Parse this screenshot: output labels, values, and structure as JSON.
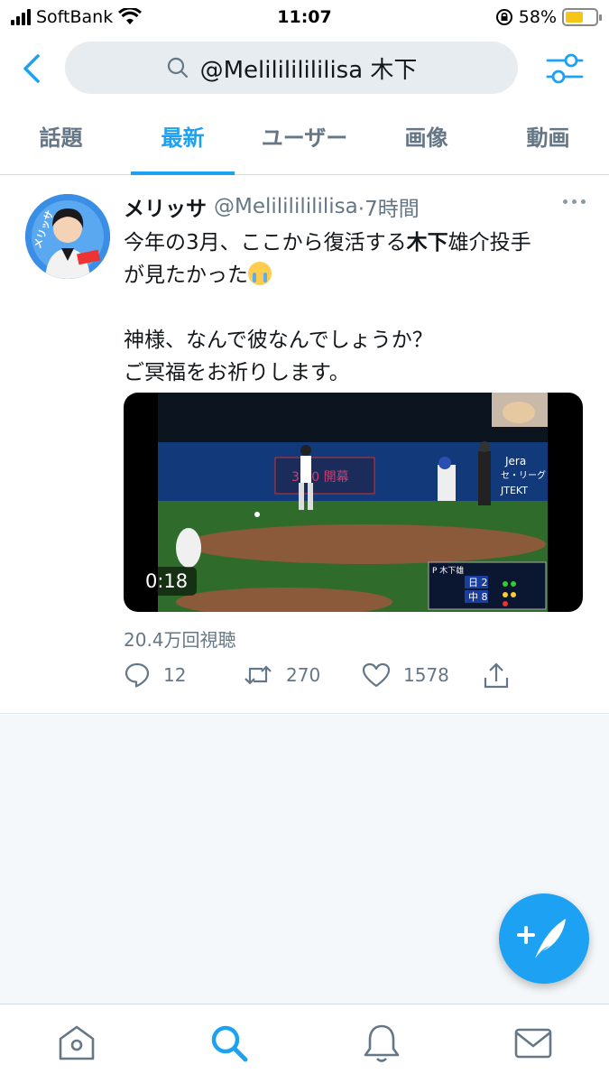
{
  "status_bar": {
    "carrier": "SoftBank",
    "time": "11:07",
    "battery_percent": "58%",
    "battery_level": 0.58
  },
  "search": {
    "query": "@Melilililililisa 木下",
    "placeholder": ""
  },
  "tabs": [
    {
      "label": "話題",
      "active": false
    },
    {
      "label": "最新",
      "active": true
    },
    {
      "label": "ユーザー",
      "active": false
    },
    {
      "label": "画像",
      "active": false
    },
    {
      "label": "動画",
      "active": false
    }
  ],
  "tweet": {
    "display_name": "メリッサ",
    "handle": "@Melilililililisa",
    "time_ago": "·7時間",
    "text_line1_pre": "今年の3月、ここから復活する",
    "text_line1_bold": "木下",
    "text_line1_post": "雄介投手",
    "text_line2": "が見たかった",
    "text_line3": "神様、なんで彼なんでしょうか？",
    "text_line4": "ご冥福をお祈りします。",
    "video_duration": "0:18",
    "views": "20.4万回視聴",
    "replies": "12",
    "retweets": "270",
    "likes": "1578"
  },
  "colors": {
    "accent": "#1da1f2",
    "muted": "#657786",
    "background_empty": "#f5f8fa"
  },
  "icons": [
    "chevron-left-icon",
    "search-icon",
    "filter-sliders-icon",
    "more-dots-icon",
    "reply-icon",
    "retweet-icon",
    "like-icon",
    "share-icon",
    "compose-icon",
    "home-icon",
    "explore-search-icon",
    "notifications-bell-icon",
    "messages-envelope-icon"
  ]
}
